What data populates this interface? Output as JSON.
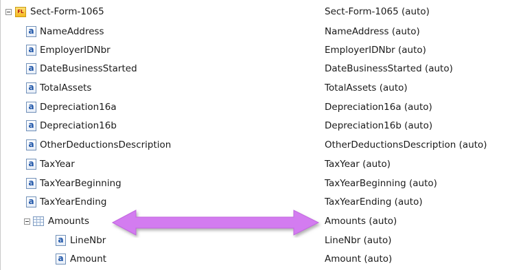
{
  "tree": {
    "root": {
      "name": "Sect-Form-1065",
      "type": "Sect-Form-1065 (auto)",
      "icon": "form-icon",
      "icon_text": "FL"
    },
    "fields": [
      {
        "name": "NameAddress",
        "type": "NameAddress (auto)"
      },
      {
        "name": "EmployerIDNbr",
        "type": "EmployerIDNbr (auto)"
      },
      {
        "name": "DateBusinessStarted",
        "type": "DateBusinessStarted (auto)"
      },
      {
        "name": "TotalAssets",
        "type": "TotalAssets (auto)"
      },
      {
        "name": "Depreciation16a",
        "type": "Depreciation16a (auto)"
      },
      {
        "name": "Depreciation16b",
        "type": "Depreciation16b (auto)"
      },
      {
        "name": "OtherDeductionsDescription",
        "type": "OtherDeductionsDescription (auto)"
      },
      {
        "name": "TaxYear",
        "type": "TaxYear (auto)"
      },
      {
        "name": "TaxYearBeginning",
        "type": "TaxYearBeginning (auto)"
      },
      {
        "name": "TaxYearEnding",
        "type": "TaxYearEnding (auto)"
      }
    ],
    "group": {
      "name": "Amounts",
      "type": "Amounts (auto)",
      "icon": "grid-icon",
      "children": [
        {
          "name": "LineNbr",
          "type": "LineNbr (auto)"
        },
        {
          "name": "Amount",
          "type": "Amount (auto)"
        }
      ]
    },
    "attr_icon_text": "a"
  },
  "colors": {
    "arrow": "#d37cf0",
    "arrow_shadow": "#8a8a8a",
    "attribute_icon": "#1e55a8",
    "form_icon": "#f5b81f"
  }
}
